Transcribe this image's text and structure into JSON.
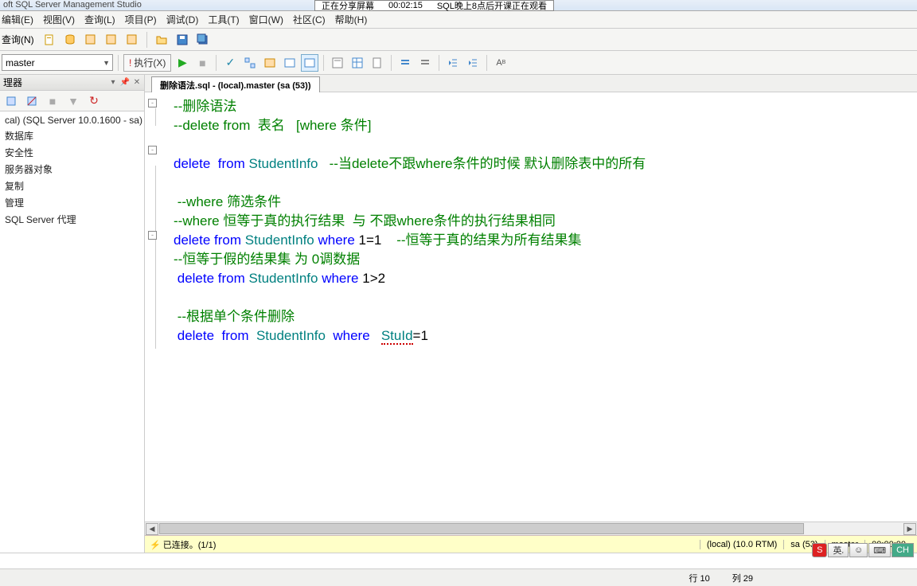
{
  "app": {
    "title": "oft SQL Server Management Studio"
  },
  "share": {
    "label": "正在分享屏幕",
    "time": "00:02:15",
    "notice": "SQL晚上8点后开课正在观看"
  },
  "menu": {
    "edit": "编辑(E)",
    "view": "视图(V)",
    "query": "查询(L)",
    "project": "项目(P)",
    "debug": "调试(D)",
    "tools": "工具(T)",
    "window": "窗口(W)",
    "community": "社区(C)",
    "help": "帮助(H)"
  },
  "toolbar": {
    "newq": "查询(N)",
    "db": "master",
    "exec": "执行(X)"
  },
  "objexp": {
    "title": "理器",
    "server": "cal) (SQL Server 10.0.1600 - sa)",
    "nodes": [
      "数据库",
      "安全性",
      "服务器对象",
      "复制",
      "管理",
      "SQL Server 代理"
    ]
  },
  "tab": {
    "title": "删除语法.sql - (local).master (sa (53))"
  },
  "code": {
    "l1a": "--删除语法",
    "l2a": "--delete from  表名   [where 条件]",
    "l4_kw1": "delete  ",
    "l4_kw2": "from ",
    "l4_id": "StudentInfo   ",
    "l4_cm": "--当delete不跟where条件的时候 默认删除表中的所有",
    "l6_cm": "--where 筛选条件",
    "l7_cm": "--where 恒等于真的执行结果  与 不跟where条件的执行结果相同",
    "l8_kw1": "delete ",
    "l8_kw2": "from ",
    "l8_id": "StudentInfo ",
    "l8_kw3": "where ",
    "l8_num": "1=1    ",
    "l8_cm": "--恒等于真的结果为所有结果集",
    "l9_cm": "--恒等于假的结果集 为 0调数据",
    "l10_kw1": "delete ",
    "l10_kw2": "from ",
    "l10_id": "StudentInfo ",
    "l10_kw3": "where ",
    "l10_num": "1>2",
    "l12_cm": "--根据单个条件删除",
    "l13_kw1": "delete  ",
    "l13_kw2": "from  ",
    "l13_id": "StudentInfo  ",
    "l13_kw3": "where   ",
    "l13_col": "StuId",
    "l13_eq": "=1"
  },
  "status": {
    "conn": "已连接。(1/1)",
    "server": "(local) (10.0 RTM)",
    "user": "sa (53)",
    "db": "master",
    "time": "00:00:00",
    "row": "行 10",
    "col": "列 29"
  },
  "ime": {
    "s": "S",
    "lang": "英",
    "emoji": "☺",
    "ch": "CH"
  }
}
